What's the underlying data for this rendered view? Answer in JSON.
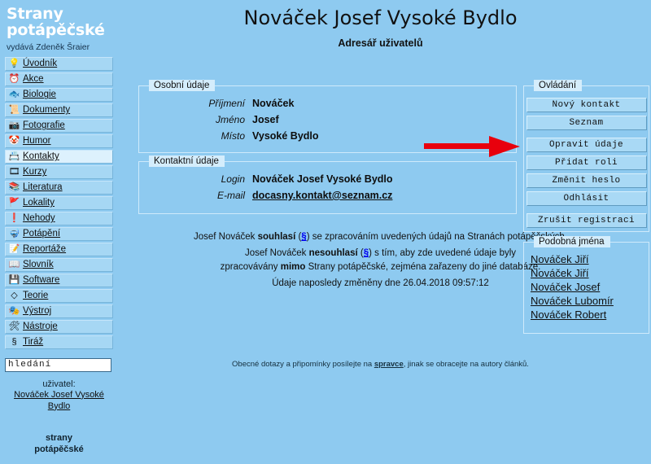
{
  "colors": {
    "background": "#8ecaf0",
    "panel": "#a6d7f4",
    "active_item": "#ddf1fd",
    "arrow": "#e8000d",
    "brand_text": "#ffffff"
  },
  "sidebar": {
    "brand_line1": "Strany",
    "brand_line2": "potápěčské",
    "publisher": "vydává Zdeněk Šraier",
    "items": [
      {
        "label": "Úvodník",
        "icon": "lightbulb-icon",
        "glyph": "💡",
        "active": false
      },
      {
        "label": "Akce",
        "icon": "clock-icon",
        "glyph": "⏰",
        "active": false
      },
      {
        "label": "Biologie",
        "icon": "fish-icon",
        "glyph": "🐟",
        "active": false
      },
      {
        "label": "Dokumenty",
        "icon": "stamp-icon",
        "glyph": "📜",
        "active": false
      },
      {
        "label": "Fotografie",
        "icon": "camera-icon",
        "glyph": "📷",
        "active": false
      },
      {
        "label": "Humor",
        "icon": "clown-icon",
        "glyph": "🤡",
        "active": false
      },
      {
        "label": "Kontakty",
        "icon": "contacts-icon",
        "glyph": "📇",
        "active": true
      },
      {
        "label": "Kurzy",
        "icon": "course-icon",
        "glyph": "🎞",
        "active": false
      },
      {
        "label": "Literatura",
        "icon": "books-icon",
        "glyph": "📚",
        "active": false
      },
      {
        "label": "Lokality",
        "icon": "dive-flag-icon",
        "glyph": "🚩",
        "active": false
      },
      {
        "label": "Nehody",
        "icon": "warning-icon",
        "glyph": "❗",
        "active": false
      },
      {
        "label": "Potápění",
        "icon": "diver-icon",
        "glyph": "🤿",
        "active": false
      },
      {
        "label": "Reportáže",
        "icon": "report-icon",
        "glyph": "📝",
        "active": false
      },
      {
        "label": "Slovník",
        "icon": "dictionary-icon",
        "glyph": "📖",
        "active": false
      },
      {
        "label": "Software",
        "icon": "floppy-icon",
        "glyph": "💾",
        "active": false
      },
      {
        "label": "Teorie",
        "icon": "diamond-icon",
        "glyph": "◇",
        "active": false
      },
      {
        "label": "Výstroj",
        "icon": "gear-icon",
        "glyph": "🎭",
        "active": false
      },
      {
        "label": "Nástroje",
        "icon": "tools-icon",
        "glyph": "🛠",
        "active": false
      },
      {
        "label": "Tiráž",
        "icon": "section-icon",
        "glyph": "§",
        "active": false
      }
    ],
    "search_value": "hledání",
    "search_placeholder": "hledání",
    "user_caption": "uživatel:",
    "user_name": "Nováček Josef Vysoké Bydlo",
    "footer_brand_line1": "strany",
    "footer_brand_line2": "potápěčské"
  },
  "main": {
    "title": "Nováček Josef Vysoké Bydlo",
    "subtitle": "Adresář uživatelů",
    "personal": {
      "legend": "Osobní údaje",
      "rows": [
        {
          "key": "Příjmení",
          "value": "Nováček"
        },
        {
          "key": "Jméno",
          "value": "Josef"
        },
        {
          "key": "Místo",
          "value": "Vysoké Bydlo"
        }
      ]
    },
    "contact": {
      "legend": "Kontaktní údaje",
      "login_key": "Login",
      "login_value": "Nováček Josef Vysoké Bydlo",
      "email_key": "E-mail",
      "email_value": "docasny.kontakt@seznam.cz"
    },
    "consent": {
      "line1_a": "Josef Nováček ",
      "line1_b": "souhlasí",
      "line1_sig": "§",
      "line1_c": " se zpracováním uvedených údajů na Stranách potápěčských.",
      "line2_a": "Josef Nováček ",
      "line2_b": "nesouhlasí",
      "line2_sig": "§",
      "line2_c": " s tím, aby zde uvedené údaje byly",
      "line3_a": "zpracovávány ",
      "line3_b": "mimo",
      "line3_c": " Strany potápěčské, zejména zařazeny do jiné databáze.",
      "changed": "Údaje naposledy změněny dne 26.04.2018 09:57:12"
    },
    "footnote": {
      "before": "Obecné dotazy a připomínky posílejte na ",
      "link": "spravce",
      "after": ", jinak se obracejte na autory článků."
    }
  },
  "controls": {
    "legend": "Ovládání",
    "buttons": [
      {
        "label": "Nový kontakt",
        "gap": false
      },
      {
        "label": "Seznam",
        "gap": false
      },
      {
        "label": "Opravit údaje",
        "gap": true
      },
      {
        "label": "Přidat roli",
        "gap": false
      },
      {
        "label": "Změnit heslo",
        "gap": false
      },
      {
        "label": "Odhlásit",
        "gap": false
      },
      {
        "label": "Zrušit registraci",
        "gap": true
      }
    ]
  },
  "similar": {
    "legend": "Podobná jména",
    "names": [
      "Nováček Jiří",
      "Nováček Jiří",
      "Nováček Josef",
      "Nováček Lubomír",
      "Nováček Robert"
    ]
  },
  "annotation": {
    "arrow_name": "red-arrow-pointing-to-opravit-udaje",
    "direction": "right"
  }
}
